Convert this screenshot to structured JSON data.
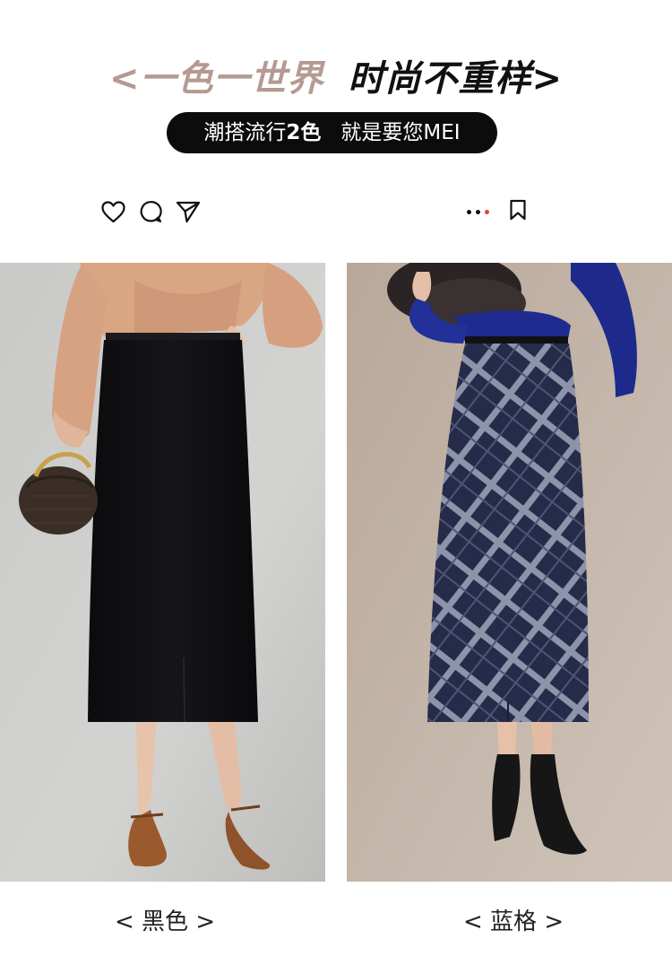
{
  "headline": {
    "left": "<一色一世界",
    "right": "时尚不重样>"
  },
  "subtitle": {
    "part1": "潮搭流行",
    "bold": "2色",
    "part2": "就是要您MEI"
  },
  "social_icons": [
    "heart-icon",
    "comment-icon",
    "share-icon"
  ],
  "right_icons": [
    "more-dots-icon",
    "bookmark-icon"
  ],
  "colors": {
    "headline_left": "#b49a92",
    "headline_right": "#111111",
    "pill_bg": "#0c0c0c",
    "dot_accent": "#e43d3d"
  },
  "products": [
    {
      "caption": "< 黑色 >",
      "color_name": "black"
    },
    {
      "caption": "< 蓝格 >",
      "color_name": "navy-plaid"
    }
  ]
}
